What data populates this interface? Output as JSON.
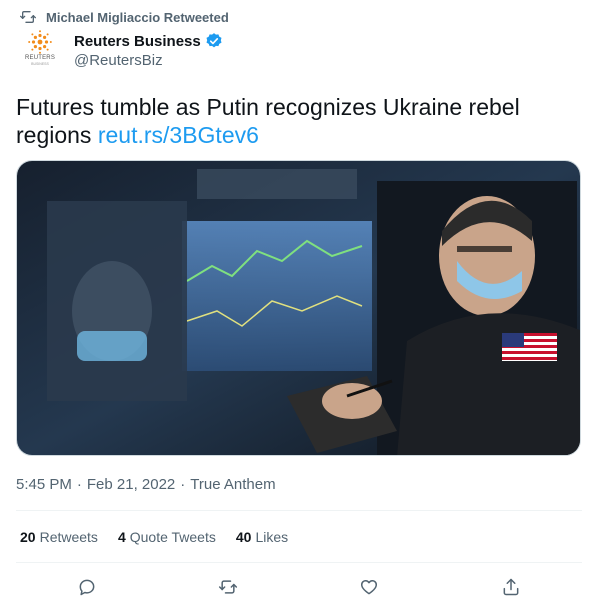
{
  "retweet": {
    "text": "Michael Migliaccio Retweeted"
  },
  "author": {
    "name": "Reuters Business",
    "handle": "@ReutersBiz",
    "logo_text": "REUTERS",
    "logo_sub": "BUSINESS",
    "verified_color": "#1d9bf0",
    "logo_color": "#f28c1b"
  },
  "tweet": {
    "text": "Futures tumble as Putin recognizes Ukraine rebel regions ",
    "link": "reut.rs/3BGtev6"
  },
  "media": {
    "description_icon": "photo"
  },
  "meta": {
    "time": "5:45 PM",
    "sep1": "·",
    "date": "Feb 21, 2022",
    "sep2": "·",
    "source": "True Anthem"
  },
  "stats": {
    "retweets_count": "20",
    "retweets_label": "Retweets",
    "quotes_count": "4",
    "quotes_label": "Quote Tweets",
    "likes_count": "40",
    "likes_label": "Likes"
  },
  "actions": {
    "reply_icon": "reply-icon",
    "retweet_icon": "retweet-icon",
    "like_icon": "like-icon",
    "share_icon": "share-icon"
  }
}
